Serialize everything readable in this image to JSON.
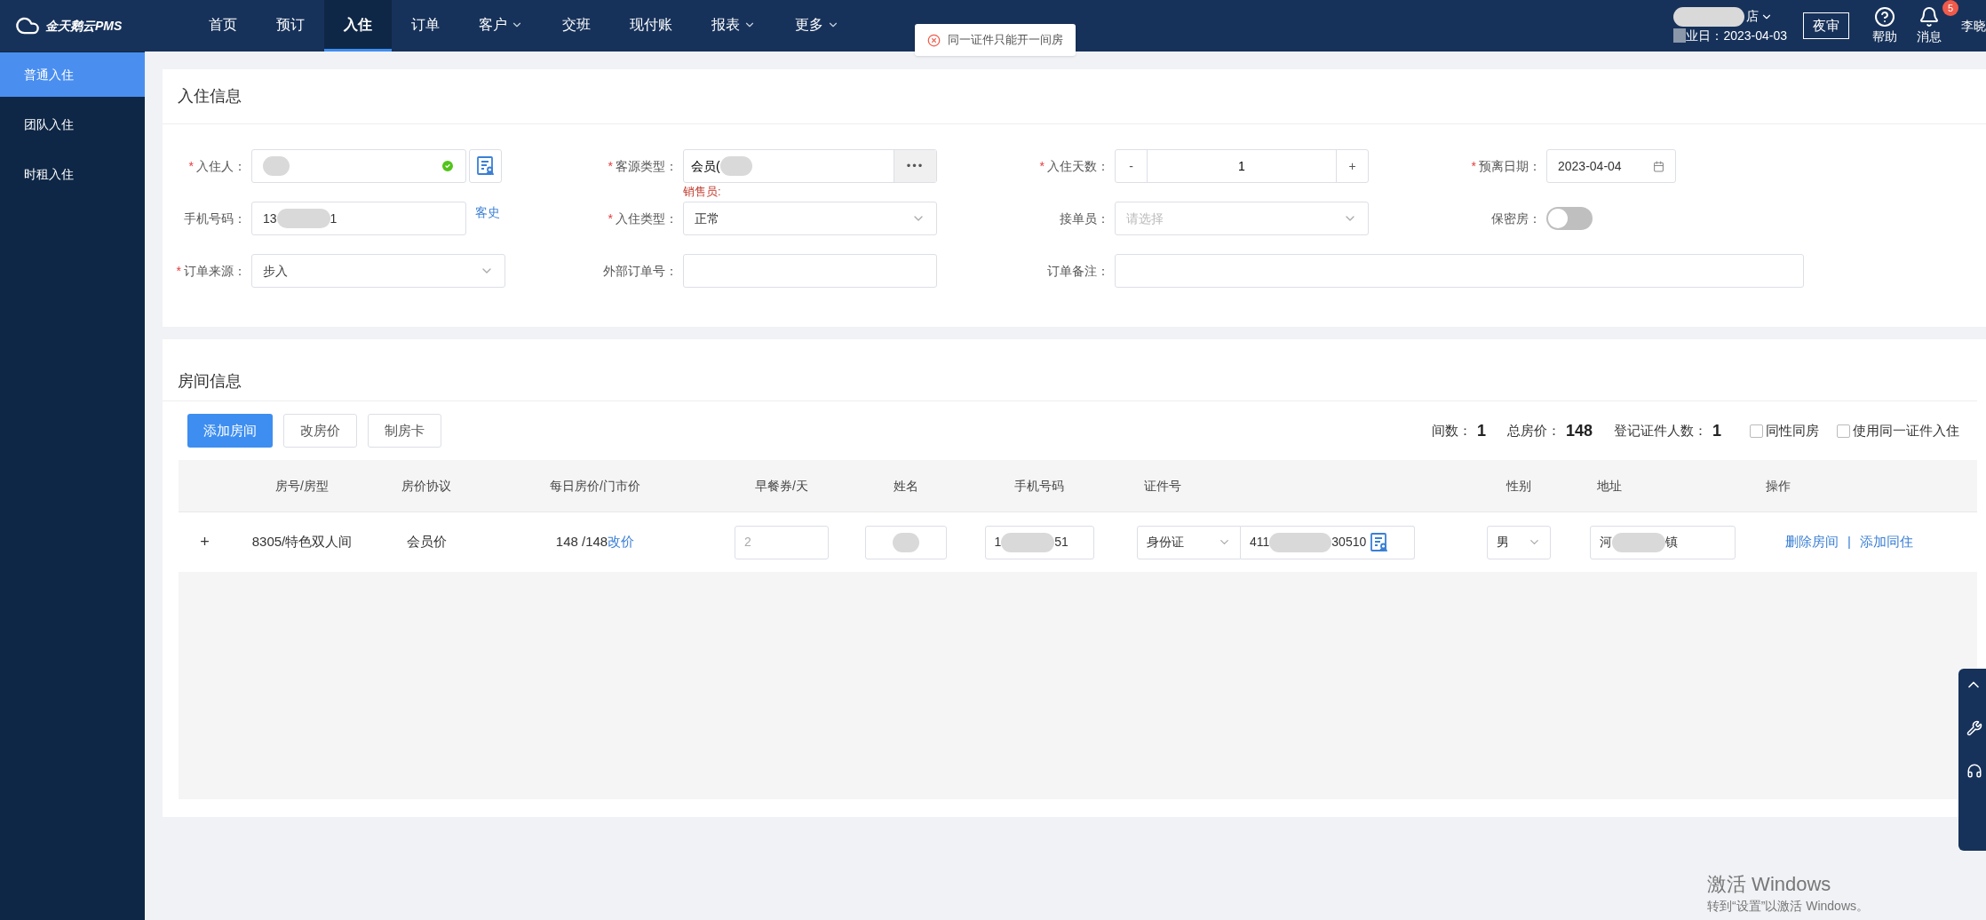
{
  "nav": {
    "logo": "金天鹅云PMS",
    "items": [
      {
        "label": "首页",
        "selected": false,
        "dropdown": false
      },
      {
        "label": "预订",
        "selected": false,
        "dropdown": false
      },
      {
        "label": "入住",
        "selected": true,
        "dropdown": false
      },
      {
        "label": "订单",
        "selected": false,
        "dropdown": false
      },
      {
        "label": "客户",
        "selected": false,
        "dropdown": true
      },
      {
        "label": "交班",
        "selected": false,
        "dropdown": false
      },
      {
        "label": "现付账",
        "selected": false,
        "dropdown": false
      },
      {
        "label": "报表",
        "selected": false,
        "dropdown": true
      },
      {
        "label": "更多",
        "selected": false,
        "dropdown": true
      }
    ]
  },
  "header": {
    "hotel": "店",
    "business_date": "业日：2023-04-03",
    "night_audit": "夜审",
    "help": "帮助",
    "messages": "消息",
    "message_count": "5",
    "user": "李晓"
  },
  "toast": {
    "text": "同一证件只能开一间房"
  },
  "sidebar": {
    "items": [
      {
        "label": "普通入住",
        "selected": true
      },
      {
        "label": "团队入住",
        "selected": false
      },
      {
        "label": "时租入住",
        "selected": false
      }
    ]
  },
  "checkin_info": {
    "title": "入住信息",
    "rows": [
      [
        {
          "kind": "guest",
          "label": "入住人：",
          "required_mark": "*",
          "verified": true
        },
        {
          "kind": "picker",
          "label": "客源类型：",
          "required_mark": "*",
          "value": "会员(",
          "note": "销售员:",
          "more": "•••"
        },
        {
          "kind": "stepper",
          "label": "入住天数：",
          "required_mark": "*",
          "value": "1",
          "minus": "-",
          "plus": "+"
        },
        {
          "kind": "date",
          "label": "预离日期：",
          "required_mark": "*",
          "value": "2023-04-04"
        }
      ],
      [
        {
          "kind": "phone",
          "label": "手机号码：",
          "value_start": "13",
          "value_end": "1",
          "link": "客史"
        },
        {
          "kind": "select",
          "label": "入住类型：",
          "required_mark": "*",
          "value": "正常"
        },
        {
          "kind": "select",
          "label": "接单员：",
          "placeholder": "请选择"
        },
        {
          "kind": "switch",
          "label": "保密房：",
          "on": false
        }
      ],
      [
        {
          "kind": "select",
          "label": "订单来源：",
          "required_mark": "*",
          "value": "步入"
        },
        {
          "kind": "text",
          "label": "外部订单号："
        },
        {
          "kind": "wide_text",
          "label": "订单备注："
        }
      ]
    ]
  },
  "room_info": {
    "title": "房间信息",
    "buttons": [
      {
        "label": "添加房间",
        "primary": true
      },
      {
        "label": "改房价",
        "primary": false
      },
      {
        "label": "制房卡",
        "primary": false
      }
    ],
    "summary": [
      {
        "label": "间数：",
        "value": "1"
      },
      {
        "label": "总房价：",
        "value": "148"
      },
      {
        "label": "登记证件人数：",
        "value": "1"
      }
    ],
    "options": [
      {
        "label": "同性同房",
        "checked": false
      },
      {
        "label": "使用同一证件入住",
        "checked": false
      }
    ],
    "table": {
      "columns": [
        "",
        "房号/房型",
        "房价协议",
        "每日房价/门市价",
        "早餐券/天",
        "姓名",
        "手机号码",
        "证件号",
        "性别",
        "地址",
        "操作"
      ],
      "rows": [
        [
          {
            "kind": "expand",
            "text": "+"
          },
          {
            "kind": "text",
            "text": "8305/特色双人间"
          },
          {
            "kind": "text",
            "text": "会员价"
          },
          {
            "kind": "price",
            "text": "148 /148",
            "link": "改价"
          },
          {
            "kind": "input",
            "value": "2",
            "disabled": true
          },
          {
            "kind": "redacted"
          },
          {
            "kind": "redacted",
            "start": "1",
            "end": "51"
          },
          {
            "kind": "id",
            "type": "身份证",
            "start": "411",
            "end": "30510"
          },
          {
            "kind": "select",
            "value": "男"
          },
          {
            "kind": "redacted",
            "start": "河",
            "end": "镇"
          },
          {
            "kind": "actions",
            "links": [
              "删除房间",
              "添加同住"
            ],
            "separator": "|"
          }
        ]
      ]
    }
  },
  "windows_notice": {
    "title": "激活 Windows",
    "text": "转到“设置”以激活 Windows。"
  }
}
